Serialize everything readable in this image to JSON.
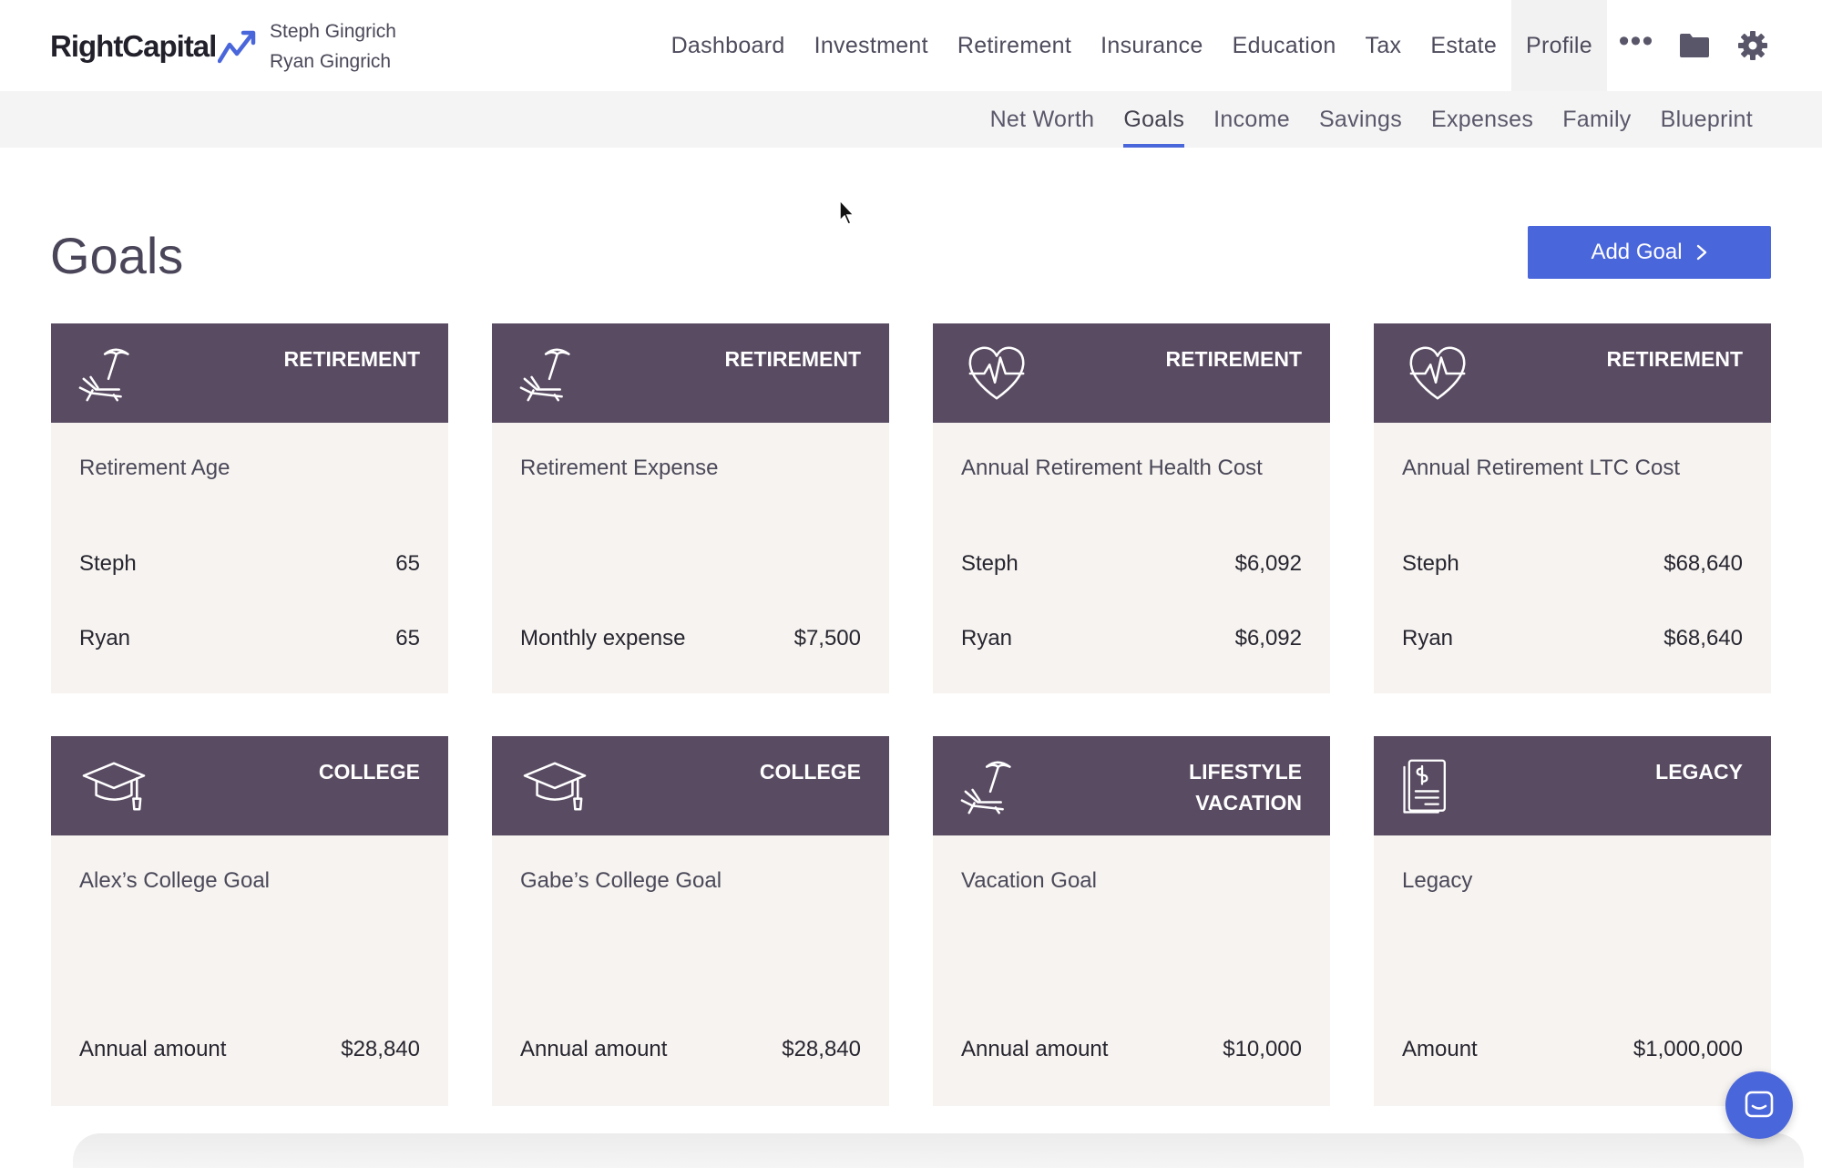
{
  "brand": {
    "name": "RightCapital",
    "accent": "#4a66db",
    "card_header": "#594b62",
    "card_body": "#f6f3f0"
  },
  "clients": [
    "Steph Gingrich",
    "Ryan Gingrich"
  ],
  "main_nav": [
    "Dashboard",
    "Investment",
    "Retirement",
    "Insurance",
    "Education",
    "Tax",
    "Estate",
    "Profile"
  ],
  "main_nav_active": "Profile",
  "nav_icons": {
    "more": "•••",
    "folder": "folder-icon",
    "settings": "gear-icon"
  },
  "sub_nav": [
    "Net Worth",
    "Goals",
    "Income",
    "Savings",
    "Expenses",
    "Family",
    "Blueprint"
  ],
  "sub_nav_active": "Goals",
  "page": {
    "title": "Goals",
    "add_button": "Add Goal",
    "add_button_icon": "chevron-right-icon"
  },
  "cards": [
    {
      "icon": "beach-chair-icon",
      "category": "RETIREMENT",
      "title": "Retirement Age",
      "rows": [
        {
          "label": "Steph",
          "value": "65"
        },
        {
          "label": "Ryan",
          "value": "65"
        }
      ]
    },
    {
      "icon": "beach-chair-icon",
      "category": "RETIREMENT",
      "title": "Retirement Expense",
      "rows": [
        {
          "label": "Monthly expense",
          "value": "$7,500"
        }
      ]
    },
    {
      "icon": "heart-pulse-icon",
      "category": "RETIREMENT",
      "title": "Annual Retirement Health Cost",
      "rows": [
        {
          "label": "Steph",
          "value": "$6,092"
        },
        {
          "label": "Ryan",
          "value": "$6,092"
        }
      ]
    },
    {
      "icon": "heart-pulse-icon",
      "category": "RETIREMENT",
      "title": "Annual Retirement LTC Cost",
      "rows": [
        {
          "label": "Steph",
          "value": "$68,640"
        },
        {
          "label": "Ryan",
          "value": "$68,640"
        }
      ]
    },
    {
      "icon": "graduation-cap-icon",
      "category": "COLLEGE",
      "title": "Alex’s College Goal",
      "rows": [
        {
          "label": "Annual amount",
          "value": "$28,840"
        }
      ]
    },
    {
      "icon": "graduation-cap-icon",
      "category": "COLLEGE",
      "title": "Gabe’s College Goal",
      "rows": [
        {
          "label": "Annual amount",
          "value": "$28,840"
        }
      ]
    },
    {
      "icon": "beach-chair-icon",
      "category_lines": [
        "LIFESTYLE",
        "VACATION"
      ],
      "title": "Vacation Goal",
      "rows": [
        {
          "label": "Annual amount",
          "value": "$10,000"
        }
      ]
    },
    {
      "icon": "document-dollar-icon",
      "category": "LEGACY",
      "title": "Legacy",
      "rows": [
        {
          "label": "Amount",
          "value": "$1,000,000"
        }
      ]
    }
  ],
  "chat_button": "chat-icon"
}
